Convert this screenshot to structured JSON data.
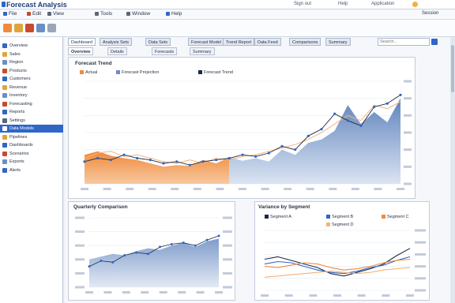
{
  "app": {
    "title": "Forecast Analysis"
  },
  "titlebar": {
    "right_items": [
      "Sign out",
      "Help",
      "Application"
    ],
    "right_badge": "Session"
  },
  "menu": {
    "items": [
      "File",
      "Edit",
      "View",
      "Tools",
      "Window",
      "Help"
    ]
  },
  "sidebar": {
    "items": [
      {
        "label": "Overview",
        "active": false
      },
      {
        "label": "Sales",
        "active": false
      },
      {
        "label": "Region",
        "active": false
      },
      {
        "label": "Products",
        "active": false
      },
      {
        "label": "Customers",
        "active": false
      },
      {
        "label": "Revenue",
        "active": false
      },
      {
        "label": "Inventory",
        "active": false
      },
      {
        "label": "Forecasting",
        "active": false
      },
      {
        "label": "Reports",
        "active": false
      },
      {
        "label": "Settings",
        "active": false
      },
      {
        "label": "Data Models",
        "active": true
      },
      {
        "label": "Pipelines",
        "active": false
      },
      {
        "label": "Dashboards",
        "active": false
      },
      {
        "label": "Scenarios",
        "active": false
      },
      {
        "label": "Exports",
        "active": false
      },
      {
        "label": "Alerts",
        "active": false
      }
    ]
  },
  "tabs": [
    "Dashboard",
    "Analysis Sets",
    "Data Sets",
    "Forecast Model",
    "Trend Report",
    "Data Feed",
    "Comparisons",
    "Summary"
  ],
  "tab_search_placeholder": "Search...",
  "subtabs": [
    "Overview",
    "Details",
    "Forecasts",
    "Summary"
  ],
  "colors": {
    "accent": "#2f66c8",
    "orange": "#f08a3c",
    "blue_area": "#6b8fc4",
    "dark_line": "#1c2a44"
  },
  "chart_data": [
    {
      "type": "area",
      "title": "Forecast Trend",
      "series": [
        {
          "name": "Actual",
          "values": [
            34,
            38,
            33,
            30,
            28,
            24,
            20,
            22,
            21,
            28,
            24,
            31,
            27,
            30,
            26,
            40,
            34,
            48,
            52,
            62,
            92,
            70,
            84,
            72,
            100
          ]
        },
        {
          "name": "Forecast Projection",
          "values": [
            30,
            36,
            38,
            32,
            34,
            30,
            26,
            24,
            28,
            24,
            30,
            28,
            32,
            34,
            38,
            42,
            46,
            52,
            60,
            70,
            80,
            74,
            92,
            88,
            96
          ]
        },
        {
          "name": "Forecast Trend",
          "values": [
            26,
            30,
            28,
            34,
            30,
            28,
            24,
            26,
            22,
            26,
            28,
            30,
            34,
            32,
            36,
            44,
            40,
            56,
            64,
            82,
            74,
            68,
            90,
            94,
            104
          ]
        }
      ],
      "ylim": [
        0,
        120
      ]
    },
    {
      "type": "area",
      "title": "Quarterly Comparison",
      "values": [
        40,
        44,
        48,
        46,
        52,
        56,
        54,
        60,
        64,
        58,
        66,
        70
      ],
      "line": [
        30,
        38,
        36,
        46,
        50,
        48,
        58,
        62,
        64,
        60,
        68,
        74
      ],
      "ylim": [
        0,
        100
      ]
    },
    {
      "type": "line",
      "title": "Variance by Segment",
      "series": [
        {
          "name": "Segment A",
          "values": [
            52,
            56,
            50,
            44,
            38,
            28,
            24,
            30,
            36,
            44,
            58,
            70
          ]
        },
        {
          "name": "Segment B",
          "values": [
            44,
            48,
            46,
            40,
            34,
            30,
            28,
            32,
            38,
            42,
            50,
            56
          ]
        },
        {
          "name": "Segment C",
          "values": [
            40,
            38,
            42,
            46,
            44,
            38,
            34,
            36,
            40,
            46,
            50,
            52
          ]
        },
        {
          "name": "Segment D",
          "values": [
            22,
            24,
            26,
            28,
            30,
            32,
            30,
            28,
            30,
            34,
            36,
            38
          ]
        }
      ],
      "ylim": [
        0,
        100
      ]
    }
  ]
}
